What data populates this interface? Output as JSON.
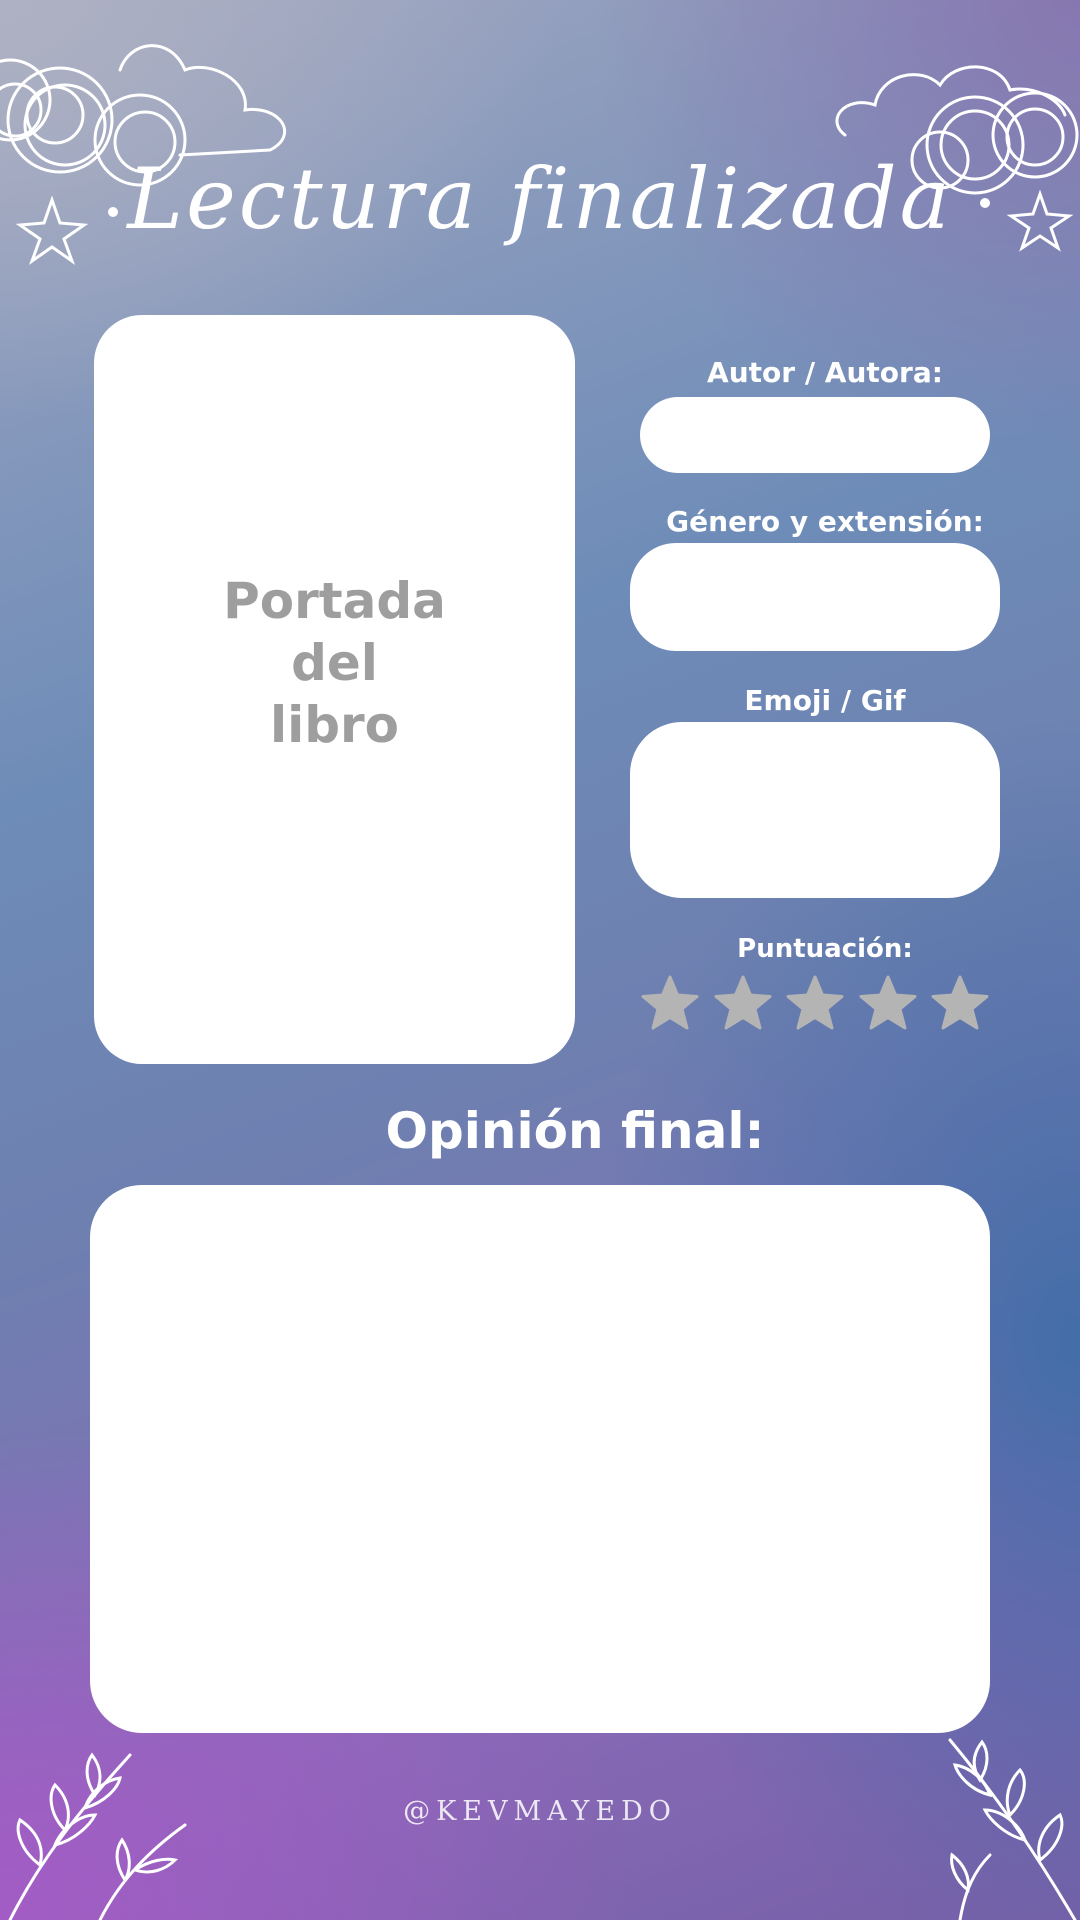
{
  "header": {
    "title": "Lectura finalizada"
  },
  "cover": {
    "placeholder_lines": [
      "Portada",
      "del",
      "libro"
    ]
  },
  "fields": {
    "author_label": "Autor / Autora:",
    "genre_label": "Género y extensión:",
    "emoji_label": "Emoji / Gif",
    "rating_label": "Puntuación:"
  },
  "rating": {
    "max_stars": 5,
    "filled_stars": 0,
    "star_color": "#b4b4b4"
  },
  "opinion": {
    "label": "Opinión final:"
  },
  "footer": {
    "credit": "@KEVMAYEDO"
  },
  "colors": {
    "panel": "#ffffff",
    "placeholder_text": "#9e9e9e",
    "label_text": "#ffffff"
  }
}
